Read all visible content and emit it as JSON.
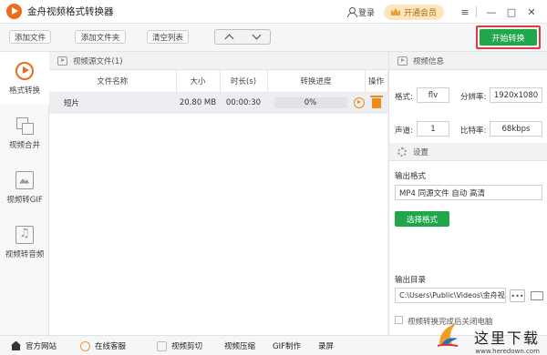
{
  "titlebar": {
    "app_title": "金舟视频格式转换器",
    "login_label": "登录",
    "vip_label": "开通会员",
    "menu_icon": "≡",
    "minimize_icon": "—",
    "maximize_icon": "□",
    "close_icon": "✕"
  },
  "toolbar": {
    "add_file": "添加文件",
    "add_folder": "添加文件夹",
    "clear_list": "清空列表",
    "start_convert": "开始转换"
  },
  "sidebar": {
    "items": [
      {
        "label": "格式转换",
        "icon": "play-icon",
        "active": true
      },
      {
        "label": "视频合并",
        "icon": "merge-icon",
        "active": false
      },
      {
        "label": "视频转GIF",
        "icon": "gif-icon",
        "active": false
      },
      {
        "label": "视频转音频",
        "icon": "audio-icon",
        "active": false
      }
    ]
  },
  "file_panel": {
    "title": "视频源文件(1)",
    "columns": [
      "文件名称",
      "大小",
      "时长(s)",
      "转换进度",
      "操作"
    ],
    "rows": [
      {
        "name": "短片",
        "size": "20.80 MB",
        "duration": "00:00:30",
        "progress": "0%"
      }
    ]
  },
  "video_info": {
    "title": "视频信息",
    "format_label": "格式:",
    "format_value": "flv",
    "resolution_label": "分辨率:",
    "resolution_value": "1920x1080",
    "channel_label": "声道:",
    "channel_value": "1",
    "bitrate_label": "比特率:",
    "bitrate_value": "68kbps"
  },
  "settings": {
    "title": "设置",
    "output_format_label": "输出格式",
    "output_format_value": "MP4 同源文件 自动 高清",
    "choose_format": "选择格式",
    "output_dir_label": "输出目录",
    "output_dir_value": "C:\\Users\\Public\\Videos\\金舟视",
    "more_label": "•••",
    "checkbox_label": "视频转换完成后关闭电脑"
  },
  "bottom_bar": {
    "official_site": "官方网站",
    "online_service": "在线客服",
    "video_cut": "视频剪切",
    "video_compress": "视频压缩",
    "gif_make": "GIF制作",
    "record_screen": "录屏"
  },
  "watermark": {
    "text": "这里下载",
    "url": "www.heredown.com"
  },
  "colors": {
    "accent_green": "#20a64b",
    "brand_orange": "#ef6a1a",
    "highlight_red": "#e0393e"
  }
}
